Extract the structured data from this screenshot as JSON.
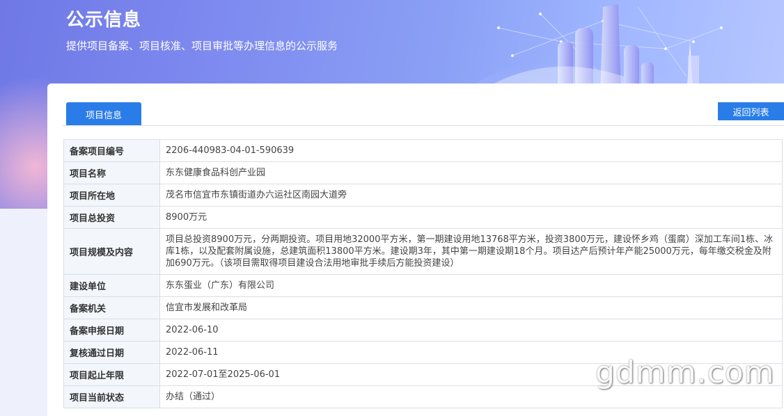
{
  "header": {
    "title": "公示信息",
    "subtitle": "提供项目备案、项目核准、项目审批等办理信息的公示服务"
  },
  "tabs": [
    {
      "label": "项目信息",
      "active": true
    }
  ],
  "back_button": "返回列表",
  "rows": [
    {
      "label": "备案项目编号",
      "value": "2206-440983-04-01-590639"
    },
    {
      "label": "项目名称",
      "value": "东东健康食品科创产业园"
    },
    {
      "label": "项目所在地",
      "value": "茂名市信宜市东镇街道办六运社区南园大道旁"
    },
    {
      "label": "项目总投资",
      "value": "8900万元"
    },
    {
      "label": "项目规模及内容",
      "value": "项目总投资8900万元，分两期投资。项目用地32000平方米，第一期建设用地13768平方米，投资3800万元，建设怀乡鸡（蛋腐）深加工车间1栋、冰库1栋，以及配套附属设施，总建筑面积13800平方米。建设期3年，其中第一期建设期18个月。项目达产后预计年产能25000万元，每年缴交税金及附加690万元。（该项目需取得项目建设合法用地审批手续后方能投资建设）"
    },
    {
      "label": "建设单位",
      "value": "东东蛋业（广东）有限公司"
    },
    {
      "label": "备案机关",
      "value": "信宜市发展和改革局"
    },
    {
      "label": "备案申报日期",
      "value": "2022-06-10"
    },
    {
      "label": "复核通过日期",
      "value": "2022-06-11"
    },
    {
      "label": "项目起止年限",
      "value": "2022-07-01至2025-06-01"
    },
    {
      "label": "项目当前状态",
      "value": "办结（通过）"
    }
  ],
  "watermark": "gdmm.com",
  "colors": {
    "accent": "#2a7de8",
    "label_bg": "#f3f6fa",
    "border": "#d9dde6"
  }
}
